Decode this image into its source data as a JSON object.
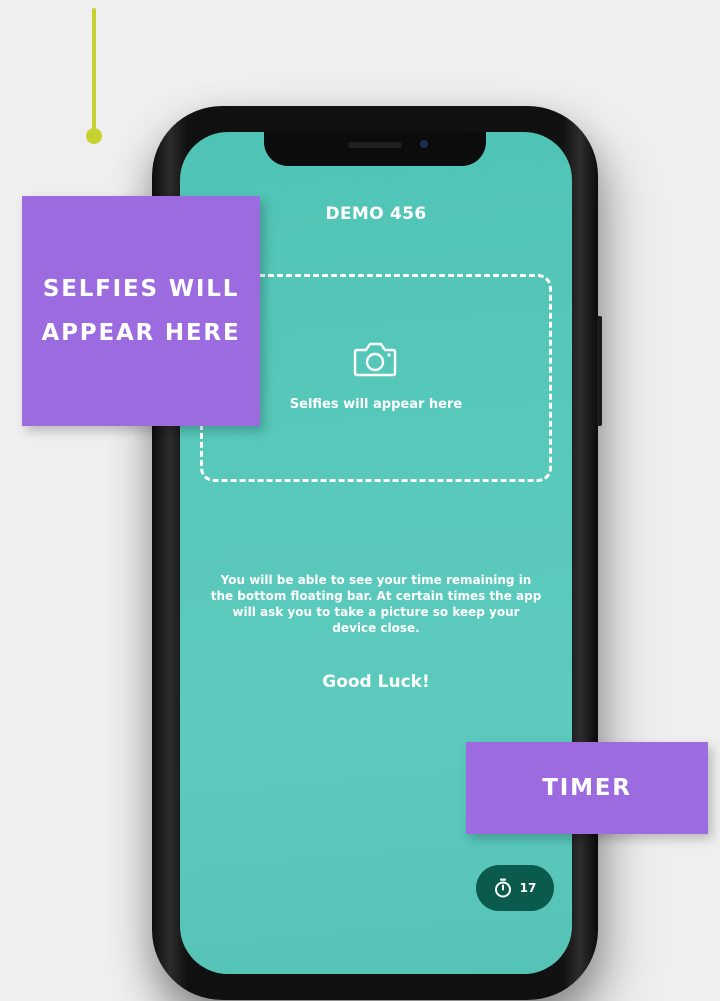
{
  "app": {
    "title": "DEMO 456",
    "selfie_placeholder": "Selfies will appear here",
    "info_text": "You will be able to see your time remaining in the bottom floating bar. At certain times the app will ask you to take a picture so keep your device close.",
    "good_luck": "Good Luck!",
    "timer": {
      "icon": "stopwatch-icon",
      "value": "17"
    }
  },
  "annotations": {
    "selfies_callout": "SELFIES WILL APPEAR HERE",
    "timer_callout": "TIMER"
  },
  "colors": {
    "screen_teal": "#56c7b9",
    "timer_pill": "#0a5a4d",
    "callout_purple": "#9b6bdf",
    "pointer_accent": "#c6d12f"
  }
}
